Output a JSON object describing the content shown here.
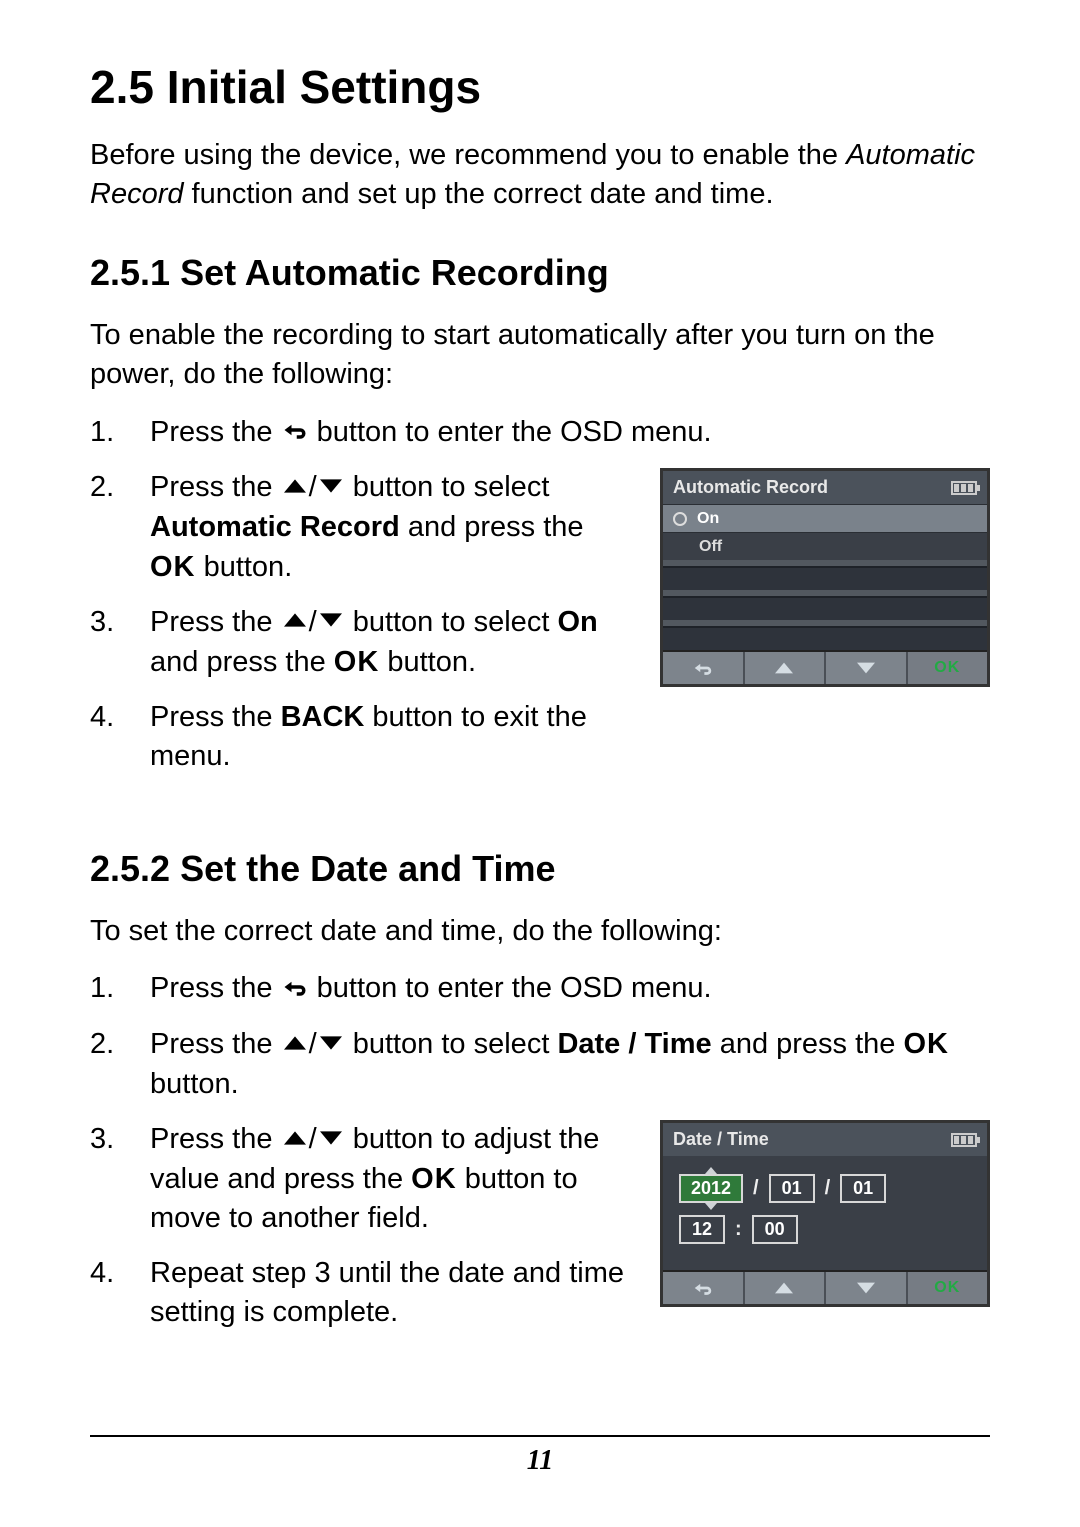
{
  "heading": "2.5   Initial Settings",
  "intro_before": "Before using the device, we recommend you to enable the ",
  "intro_em": "Automatic Record",
  "intro_after": " function and set up the correct date and time.",
  "s251": {
    "heading": "2.5.1    Set Automatic Recording",
    "intro": "To enable the recording to start automatically after you turn on the power, do the following:",
    "step1_a": "Press the ",
    "step1_b": " button to enter the OSD menu.",
    "step2_a": "Press the ",
    "step2_b": " button to select ",
    "step2_bold": "Automatic Record",
    "step2_c": " and press the ",
    "step2_d": " button.",
    "step3_a": "Press the ",
    "step3_b": " button to select ",
    "step3_bold": "On",
    "step3_c": " and press the ",
    "step3_d": " button.",
    "step4_a": "Press the ",
    "step4_bold": "BACK",
    "step4_b": " button to exit the menu."
  },
  "osd1": {
    "title": "Automatic Record",
    "opt_on": "On",
    "opt_off": "Off",
    "ok": "OK"
  },
  "s252": {
    "heading": "2.5.2    Set the Date and Time",
    "intro": "To set the correct date and time, do the following:",
    "step1_a": "Press the ",
    "step1_b": " button to enter the OSD menu.",
    "step2_a": "Press the ",
    "step2_b": " button to select ",
    "step2_bold": "Date / Time",
    "step2_c": " and press the ",
    "step2_d": " button.",
    "step3_a": "Press the ",
    "step3_b": " button to adjust the value and press the ",
    "step3_c": " button to move to another field.",
    "step4": "Repeat step 3 until the date and time setting is complete."
  },
  "osd2": {
    "title": "Date / Time",
    "year": "2012",
    "month": "01",
    "day": "01",
    "hour": "12",
    "minute": "00",
    "ok": "OK"
  },
  "ok_label": "OK",
  "page_number": "11"
}
